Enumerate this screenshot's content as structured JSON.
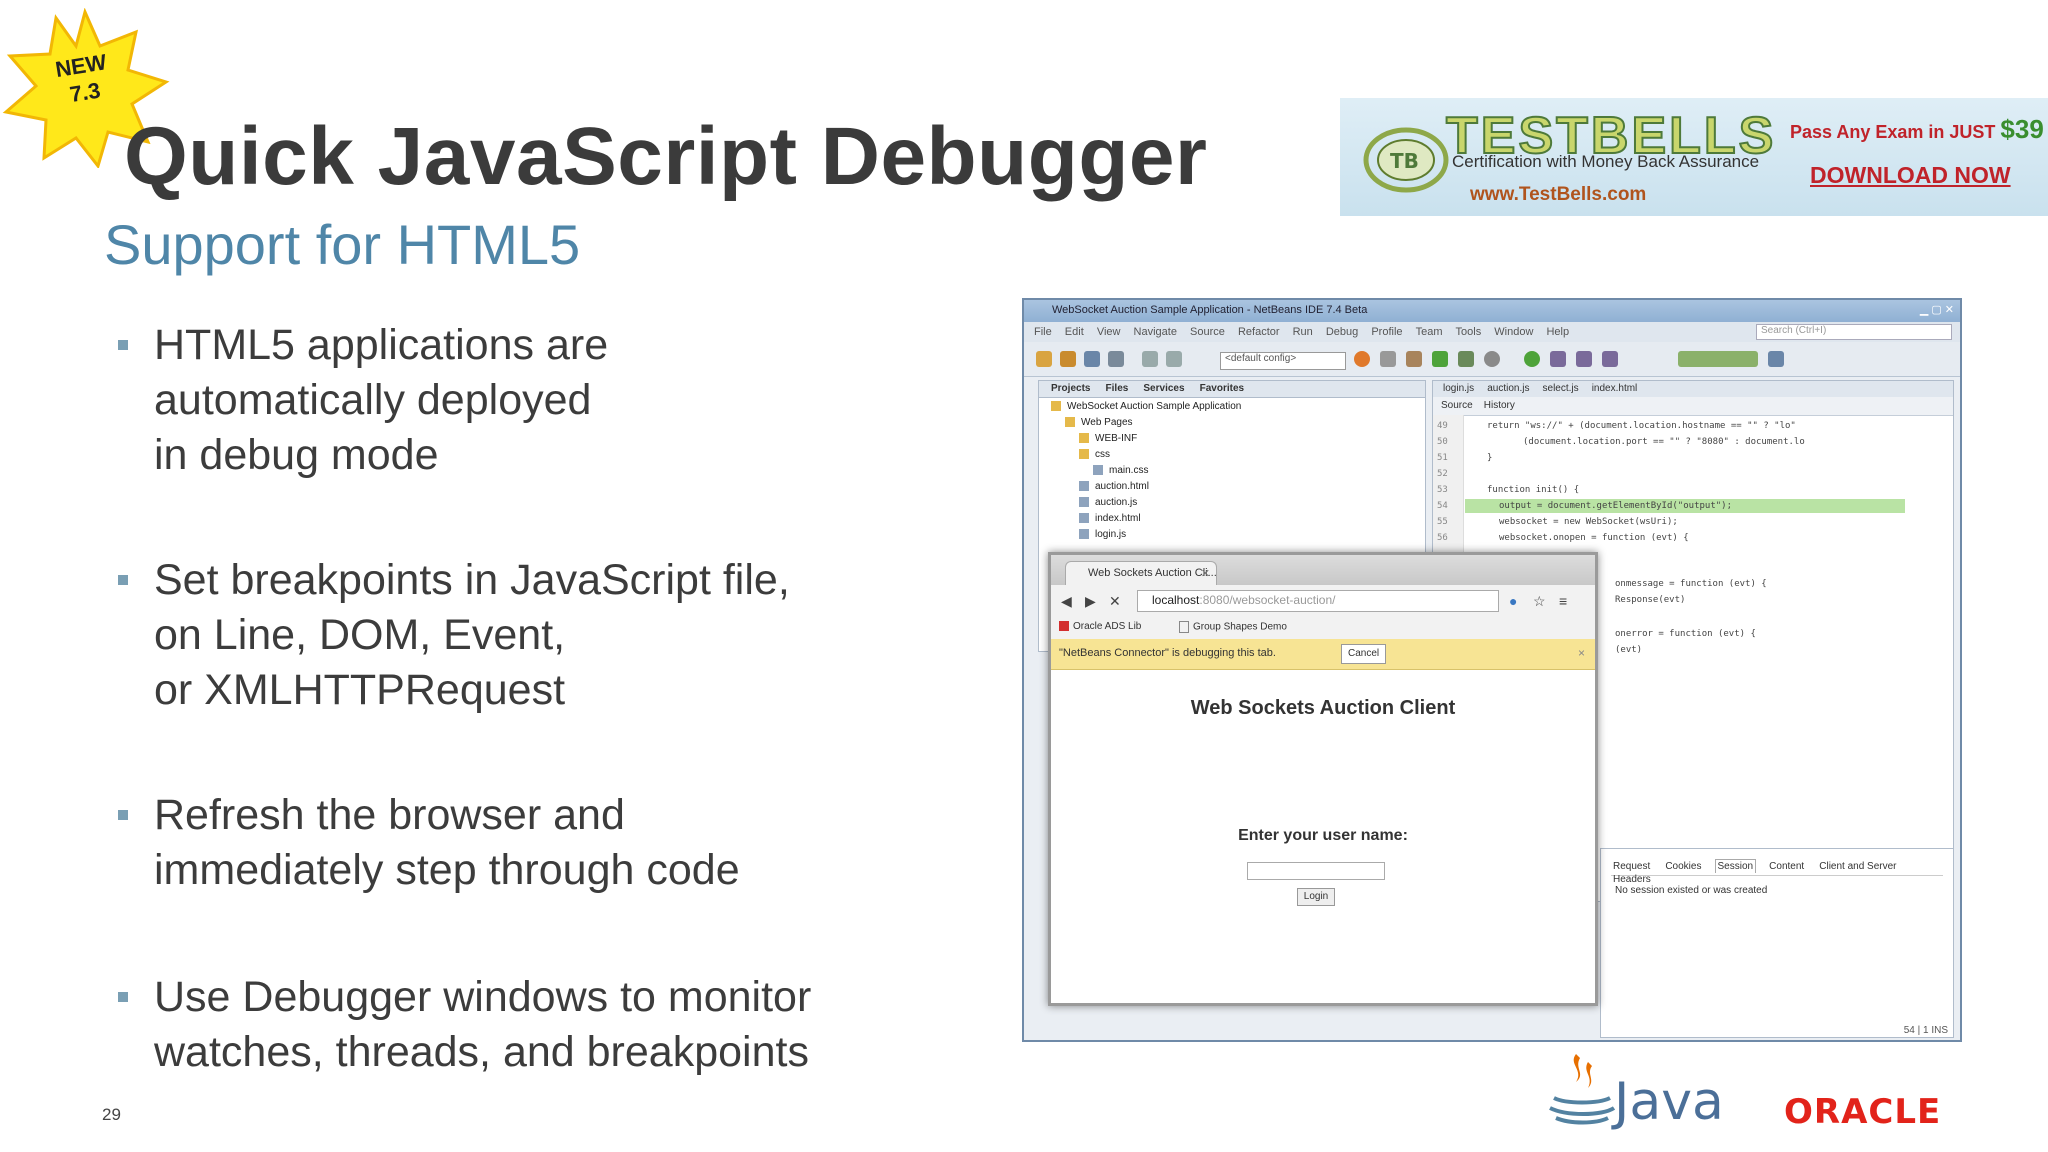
{
  "badge": {
    "line1": "NEW",
    "line2": "7.3"
  },
  "title": "Quick JavaScript Debugger",
  "subtitle": "Support for HTML5",
  "bullets": [
    {
      "lines": [
        "HTML5 applications are",
        "automatically deployed",
        "in debug mode"
      ]
    },
    {
      "lines": [
        "Set breakpoints in JavaScript file,",
        "on Line, DOM, Event,",
        "or XMLHTTPRequest"
      ]
    },
    {
      "lines": [
        "Refresh the browser and",
        "immediately step through code"
      ]
    },
    {
      "lines": [
        "Use Debugger windows to monitor",
        "watches, threads, and breakpoints"
      ]
    }
  ],
  "slide_number": "29",
  "ad": {
    "brand": "TESTBELLS",
    "tagline": "Certification with Money Back Assurance",
    "url": "www.TestBells.com",
    "offer": "Pass Any Exam in JUST ",
    "price": "$39",
    "download": "DOWNLOAD NOW"
  },
  "ide": {
    "title": "WebSocket Auction Sample Application - NetBeans IDE 7.4 Beta",
    "menu": [
      "File",
      "Edit",
      "View",
      "Navigate",
      "Source",
      "Refactor",
      "Run",
      "Debug",
      "Profile",
      "Team",
      "Tools",
      "Window",
      "Help"
    ],
    "search_placeholder": "Search (Ctrl+I)",
    "config": "<default config>",
    "project_tabs": [
      "Projects",
      "Files",
      "Services",
      "Favorites"
    ],
    "tree": [
      "WebSocket Auction Sample Application",
      "Web Pages",
      "WEB-INF",
      "css",
      "main.css",
      "auction.html",
      "auction.js",
      "index.html",
      "login.js"
    ],
    "editor_tabs": [
      "login.js",
      "auction.js",
      "select.js",
      "index.html"
    ],
    "editor_subtabs": [
      "Source",
      "History"
    ],
    "line_numbers": [
      "49",
      "50",
      "51",
      "52",
      "53",
      "54",
      "55",
      "56"
    ],
    "code": [
      "return \"ws://\" + (document.location.hostname == \"\" ? \"lo\"",
      "(document.location.port == \"\" ? \"8080\" : document.lo",
      "}",
      "",
      "function init() {",
      "output = document.getElementById(\"output\");",
      "websocket = new WebSocket(wsUri);",
      "websocket.onopen = function (evt) {"
    ],
    "code_right": [
      "onmessage = function (evt) {",
      "Response(evt)",
      "onerror = function (evt) {",
      "(evt)"
    ],
    "net_tabs": [
      "Request",
      "Cookies",
      "Session",
      "Content",
      "Client and Server",
      "Headers"
    ],
    "net_message": "No session existed or was created",
    "status": "54 | 1     INS"
  },
  "browser": {
    "tab_label": "Web Sockets Auction Cli...",
    "address_host": "localhost",
    "address_path": ":8080/websocket-auction/",
    "bookmarks": [
      "Oracle ADS Lib",
      "Group Shapes Demo"
    ],
    "debug_message": "\"NetBeans Connector\" is debugging this tab.",
    "cancel": "Cancel",
    "heading": "Web Sockets Auction Client",
    "username_label": "Enter your user name:",
    "login": "Login"
  },
  "logos": {
    "java": "Java",
    "oracle": "ORACLE"
  },
  "colors": {
    "title": "#3b3b3b",
    "subtitle": "#4f86a8",
    "bullet": "#7a9fb4",
    "oracle_red": "#e2231a",
    "badge_yellow": "#ffe81a"
  },
  "icons": [
    "starburst-badge",
    "testbells-logo-icon",
    "java-cup-icon",
    "square-bullet-icon"
  ]
}
